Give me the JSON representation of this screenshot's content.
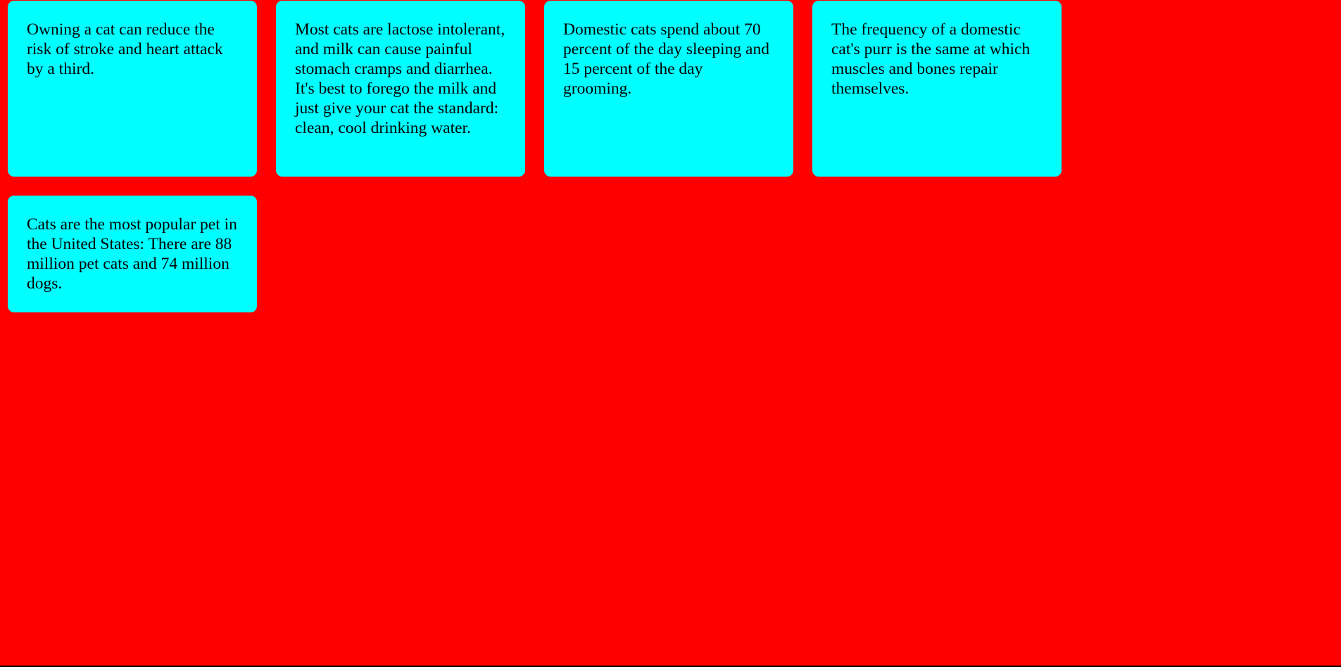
{
  "theme": {
    "background_color": "#ff0000",
    "card_color": "#00ffff",
    "text_color": "#000000"
  },
  "facts": [
    {
      "text": "Owning a cat can reduce the risk of stroke and heart attack by a third."
    },
    {
      "text": "Most cats are lactose intolerant, and milk can cause painful stomach cramps and diarrhea. It's best to forego the milk and just give your cat the standard: clean, cool drinking water."
    },
    {
      "text": "Domestic cats spend about 70 percent of the day sleeping and 15 percent of the day grooming."
    },
    {
      "text": "The frequency of a domestic cat's purr is the same at which muscles and bones repair themselves."
    },
    {
      "text": "Cats are the most popular pet in the United States: There are 88 million pet cats and 74 million dogs."
    }
  ]
}
